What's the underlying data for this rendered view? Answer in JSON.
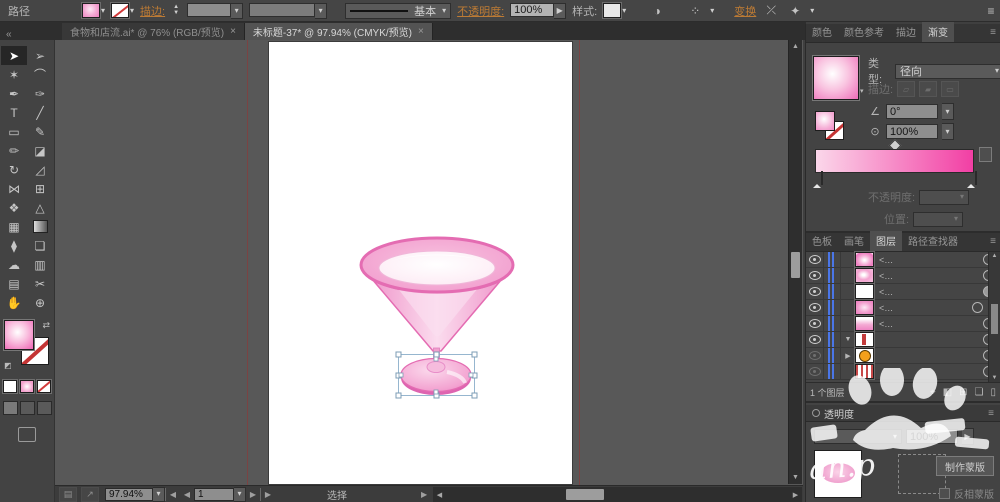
{
  "colors": {
    "accent_orange": "#bd7b35",
    "grad_start": "#fbd7ea",
    "grad_end": "#f23fa4",
    "guide_red": "#7a4343",
    "layer_blue": "#4a76e8"
  },
  "icons": {
    "menu": "≡",
    "dd": "▾",
    "left": "◀",
    "right": "▶",
    "up": "▲",
    "down": "▼",
    "collapse": "«",
    "swap": "⇄",
    "reset": "◩",
    "angle": "∠",
    "aspect": "⊙",
    "reverse": "⇆",
    "recolor": "◑",
    "align": "⁘",
    "constrain": "⤫",
    "shear": "✦",
    "tri_open": "▼",
    "tri_closed": "▶",
    "locate": "⌖",
    "clip_mask": "◧",
    "new_sublayer": "⊞",
    "new_layer": "❏",
    "trash": "▯",
    "status_a": "▤",
    "status_b": "↗",
    "spin_up": "▲",
    "spin_down": "▼"
  },
  "control_bar": {
    "object_label": "路径",
    "stroke_link": "描边:",
    "brush_value": "基本",
    "opacity_link": "不透明度:",
    "opacity_value": "100%",
    "style_label": "样式:",
    "transform_link": "变换"
  },
  "tab_bar": {
    "tabs": [
      {
        "title": "食物和店流.ai* @ 76% (RGB/预览)",
        "close": "×",
        "active": false
      },
      {
        "title": "未标题-37* @ 97.94% (CMYK/预览)",
        "close": "×",
        "active": true
      }
    ]
  },
  "toolbar": {
    "tools": [
      {
        "name": "selection",
        "glyph": "➤",
        "selected": true
      },
      {
        "name": "direct-selection",
        "glyph": "➢"
      },
      {
        "name": "magic-wand",
        "glyph": "✶"
      },
      {
        "name": "lasso",
        "glyph": "⌒"
      },
      {
        "name": "pen",
        "glyph": "✒"
      },
      {
        "name": "curvature",
        "glyph": "✑"
      },
      {
        "name": "type",
        "glyph": "T"
      },
      {
        "name": "line-segment",
        "glyph": "╱"
      },
      {
        "name": "rectangle",
        "glyph": "▭"
      },
      {
        "name": "paintbrush",
        "glyph": "✎"
      },
      {
        "name": "pencil",
        "glyph": "✏"
      },
      {
        "name": "eraser",
        "glyph": "◪"
      },
      {
        "name": "rotate",
        "glyph": "↻"
      },
      {
        "name": "scale",
        "glyph": "◿"
      },
      {
        "name": "width-tool",
        "glyph": "⋈"
      },
      {
        "name": "free-transform",
        "glyph": "⊞"
      },
      {
        "name": "shape-builder",
        "glyph": "❖"
      },
      {
        "name": "perspective-grid",
        "glyph": "△"
      },
      {
        "name": "mesh",
        "glyph": "▦"
      },
      {
        "name": "gradient",
        "glyph": ""
      },
      {
        "name": "eyedropper",
        "glyph": "⧫"
      },
      {
        "name": "blend",
        "glyph": "❏"
      },
      {
        "name": "symbol-sprayer",
        "glyph": "☁"
      },
      {
        "name": "column-graph",
        "glyph": "▥"
      },
      {
        "name": "artboard",
        "glyph": "▤"
      },
      {
        "name": "slice",
        "glyph": "✂"
      },
      {
        "name": "hand",
        "glyph": "✋"
      },
      {
        "name": "zoom",
        "glyph": "⊕"
      }
    ]
  },
  "dock": {
    "gradient": {
      "tabs": [
        "颜色",
        "颜色参考",
        "描边",
        "渐变"
      ],
      "type_label": "类型:",
      "type_value": "径向",
      "stroke_label": "描边:",
      "angle_value": "0°",
      "aspect_value": "100%",
      "opacity_label": "不透明度:",
      "location_label": "位置:"
    },
    "layers": {
      "tabs": [
        "色板",
        "画笔",
        "图层",
        "路径查找器"
      ],
      "rows": [
        {
          "thumb": "pink1",
          "label": "<…",
          "eye": "on",
          "target": "ring",
          "disclosure": "",
          "chip": false
        },
        {
          "thumb": "pink2",
          "label": "<…",
          "eye": "on",
          "target": "ring",
          "disclosure": "",
          "chip": false
        },
        {
          "thumb": "white",
          "label": "<…",
          "eye": "on",
          "target": "filled",
          "disclosure": "",
          "chip": false
        },
        {
          "thumb": "pink3",
          "label": "<…",
          "eye": "on",
          "target": "ring",
          "disclosure": "",
          "chip": true
        },
        {
          "thumb": "pink4",
          "label": "<…",
          "eye": "on",
          "target": "ring",
          "disclosure": "",
          "chip": false
        },
        {
          "thumb": "redshape",
          "label": "",
          "eye": "on",
          "target": "ring",
          "disclosure": "open",
          "chip": false
        },
        {
          "thumb": "orangec",
          "label": "",
          "eye": "dim",
          "target": "ring",
          "disclosure": "closed",
          "chip": false
        },
        {
          "thumb": "stripes",
          "label": "",
          "eye": "dim",
          "target": "ring",
          "disclosure": "",
          "chip": false
        }
      ],
      "footer_count": "1 个图层"
    },
    "transparency": {
      "title": "透明度",
      "blend_value": "",
      "opacity_value": "100%",
      "make_mask_label": "制作蒙版",
      "invert_mask_label": "反相蒙版"
    }
  },
  "status_bar": {
    "zoom_value": "97.94%",
    "artboard_value": "1",
    "status_text": "选择"
  },
  "watermark": {
    "text": "an.p"
  }
}
